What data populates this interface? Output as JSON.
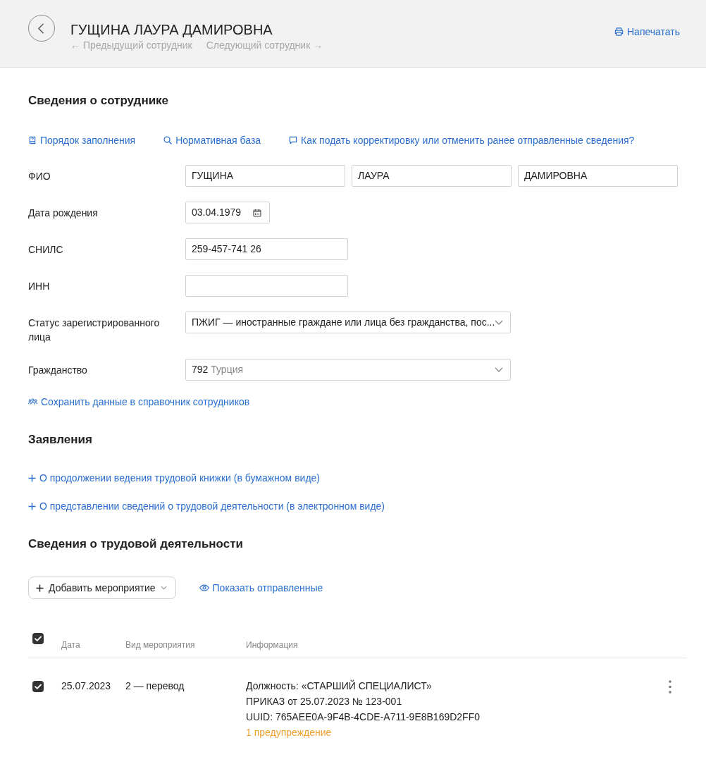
{
  "header": {
    "title": "ГУЩИНА ЛАУРА ДАМИРОВНА",
    "nav": [
      "← Предыдущий сотрудник",
      "Следующий сотрудник →"
    ],
    "print_link": "Напечатать"
  },
  "employee_section": {
    "title": "Сведения о сотруднике",
    "help_links": [
      "Порядок заполнения",
      "Нормативная база",
      "Как подать корректировку или отменить ранее отправленные сведения?"
    ],
    "fields": [
      {
        "kind": "name",
        "label": "ФИО",
        "values": [
          "ГУЩИНА",
          "ЛАУРА",
          "ДАМИРОВНА"
        ]
      },
      {
        "kind": "date",
        "label": "Дата рождения",
        "value": "03.04.1979"
      },
      {
        "kind": "text",
        "label": "СНИЛС",
        "value": "259-457-741 26"
      },
      {
        "kind": "text",
        "label": "ИНН"
      },
      {
        "kind": "select",
        "label": "Статус зарегистрированного лица",
        "value": "ПЖИГ — иностранные граждане или лица без гражданства, пос..."
      },
      {
        "kind": "select",
        "label": "Гражданство",
        "code": "792",
        "value": "Турция"
      }
    ],
    "save_link": "Сохранить данные в справочник сотрудников"
  },
  "applications_section": {
    "title": "Заявления",
    "links": [
      "О продолжении ведения трудовой книжки (в бумажном виде)",
      "О представлении сведений о трудовой деятельности (в электронном виде)"
    ]
  },
  "activity_section": {
    "title": "Сведения о трудовой деятельности",
    "add_button": "Добавить мероприятие",
    "show_sent_link": "Показать отправленные",
    "table": {
      "all_checked": true,
      "columns": [
        "Дата",
        "Вид мероприятия",
        "Информация"
      ],
      "rows": [
        {
          "checked": true,
          "date": "25.07.2023",
          "event_type": "2 — перевод",
          "info": [
            "Должность: «СТАРШИЙ СПЕЦИАЛИСТ»",
            "ПРИКАЗ от 25.07.2023 № 123-001",
            "UUID: 765AEE0A-9F4B-4CDE-A711-9E8B169D2FF0"
          ],
          "warning": "1 предупреждение"
        }
      ]
    }
  }
}
